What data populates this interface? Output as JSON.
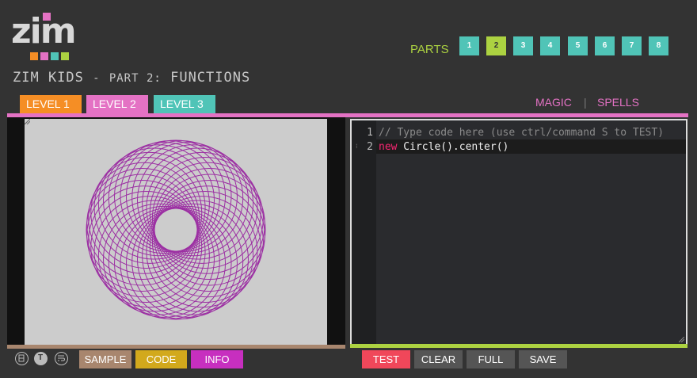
{
  "logo": {
    "letters": "zim",
    "colors": [
      "#f58e25",
      "#e472c4",
      "#50c4b7",
      "#acd241"
    ]
  },
  "title": {
    "main": "ZIM KIDS",
    "dash": "-",
    "part": "PART 2:",
    "topic": "FUNCTIONS"
  },
  "parts": {
    "label": "PARTS",
    "items": [
      "1",
      "2",
      "3",
      "4",
      "5",
      "6",
      "7",
      "8"
    ],
    "active": "2"
  },
  "levels": [
    {
      "label": "LEVEL 1",
      "color": "#f58e25"
    },
    {
      "label": "LEVEL 2",
      "color": "#e472c4"
    },
    {
      "label": "LEVEL 3",
      "color": "#50c4b7"
    }
  ],
  "links": {
    "magic": "MAGIC",
    "separator": "|",
    "spells": "SPELLS"
  },
  "editor": {
    "line_numbers": [
      "1",
      "2"
    ],
    "line1_comment": "// Type code here (use ctrl/command S to TEST)",
    "line2_keyword": "new",
    "line2_code": " Circle().center()"
  },
  "stage": {
    "ring_color": "#9c2fa3",
    "background": "#cccccc"
  },
  "controls": {
    "icons": [
      "layout-icon",
      "text-size-icon",
      "wrap-icon"
    ],
    "text_icon_letter": "T"
  },
  "buttons": {
    "sample": "SAMPLE",
    "code": "CODE",
    "info": "INFO",
    "test": "TEST",
    "clear": "CLEAR",
    "full": "FULL",
    "save": "SAVE"
  },
  "colors": {
    "pink": "#e472c4",
    "green": "#acd241",
    "teal": "#50c4b7",
    "orange": "#f58e25",
    "sample": "#a8866e",
    "code": "#d2a91c",
    "info": "#c72fbf",
    "test": "#f0475a",
    "gray_btn": "#555555"
  }
}
